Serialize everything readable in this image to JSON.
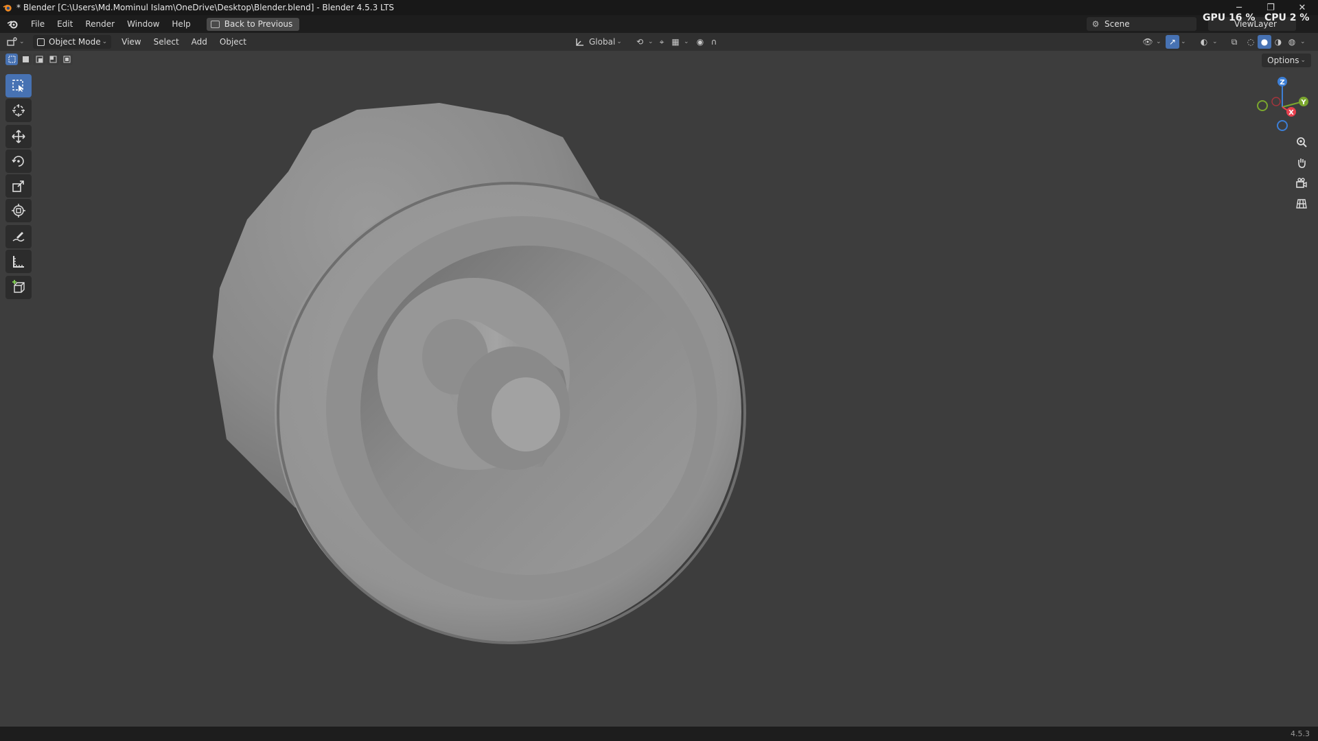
{
  "window": {
    "title": "* Blender [C:\\Users\\Md.Mominul Islam\\OneDrive\\Desktop\\Blender.blend] - Blender 4.5.3 LTS",
    "minimize": "─",
    "restore": "❐",
    "close": "✕"
  },
  "menubar": {
    "items": [
      "File",
      "Edit",
      "Render",
      "Window",
      "Help"
    ],
    "back_button": "Back to Previous",
    "scene": "Scene",
    "view_layer": "ViewLayer",
    "gpu_label": "GPU",
    "gpu_value": "16 %",
    "cpu_label": "CPU",
    "cpu_value": "2 %"
  },
  "header": {
    "mode": "Object Mode",
    "menus": [
      "View",
      "Select",
      "Add",
      "Object"
    ],
    "transform_orientation": "Global",
    "options": "Options"
  },
  "toolbar": {
    "tools": [
      "select-box",
      "cursor",
      "move",
      "rotate",
      "scale",
      "transform",
      "annotate",
      "measure",
      "add-cube"
    ],
    "active_tool": "select-box"
  },
  "gizmo": {
    "axes": [
      "Z",
      "Y",
      "X"
    ],
    "colors": {
      "x": "#e8404e",
      "y": "#7ba72e",
      "z": "#3d7fd6"
    }
  },
  "statusbar": {
    "version": "4.5.3"
  },
  "colors": {
    "accent": "#4772b3",
    "viewport_bg": "#3d3d3d"
  }
}
